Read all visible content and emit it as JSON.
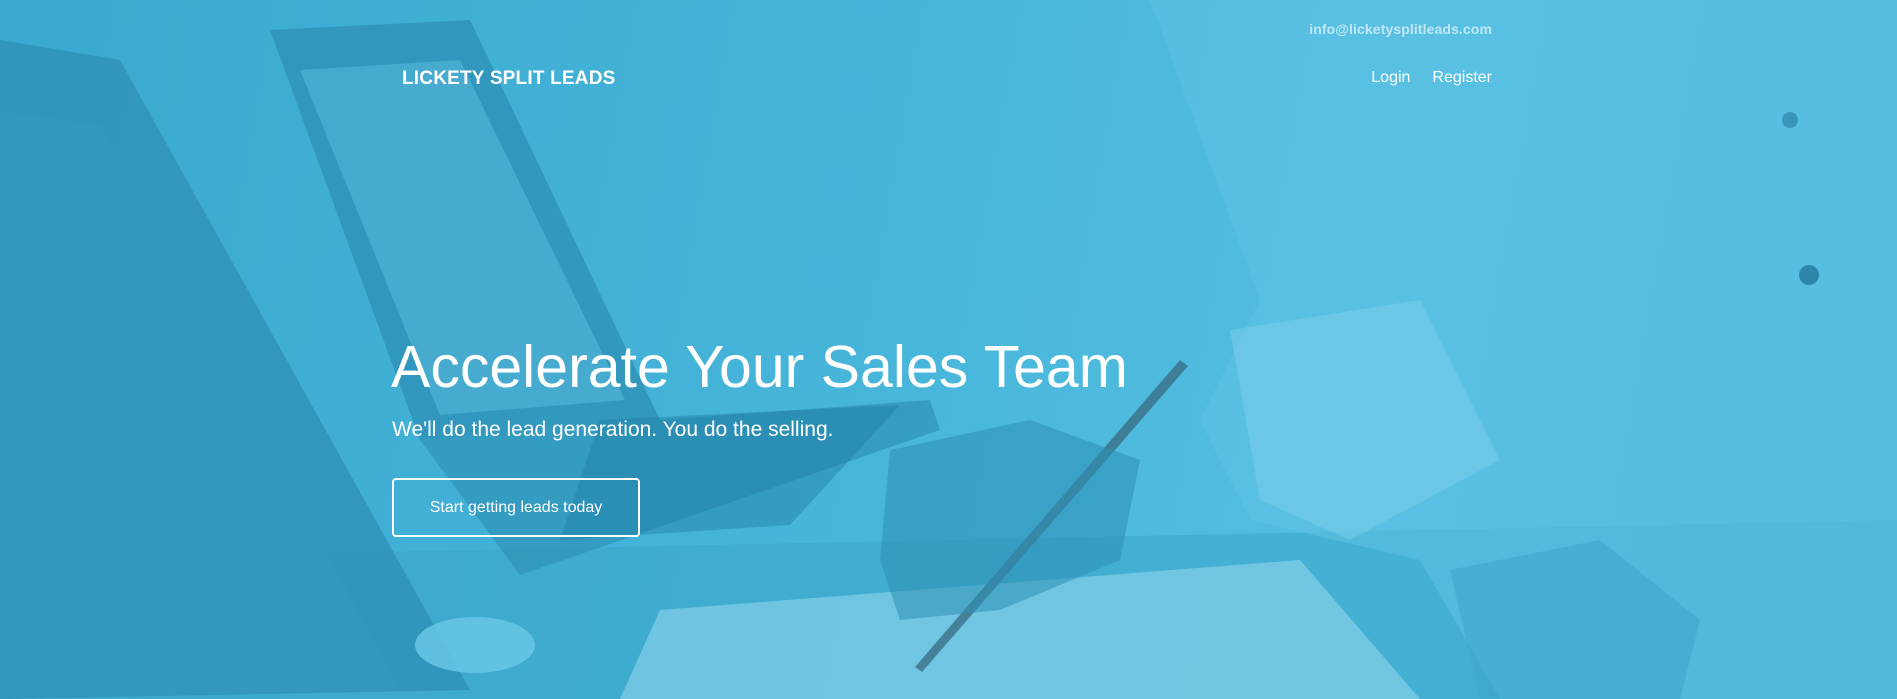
{
  "header": {
    "email": "info@licketysplitleads.com",
    "brand": "LICKETY SPLIT LEADS",
    "nav": {
      "login": "Login",
      "register": "Register"
    }
  },
  "hero": {
    "headline": "Accelerate Your Sales Team",
    "subheadline": "We'll do the lead generation. You do the selling.",
    "cta_label": "Start getting leads today",
    "overlay_color": "#47b5da"
  }
}
